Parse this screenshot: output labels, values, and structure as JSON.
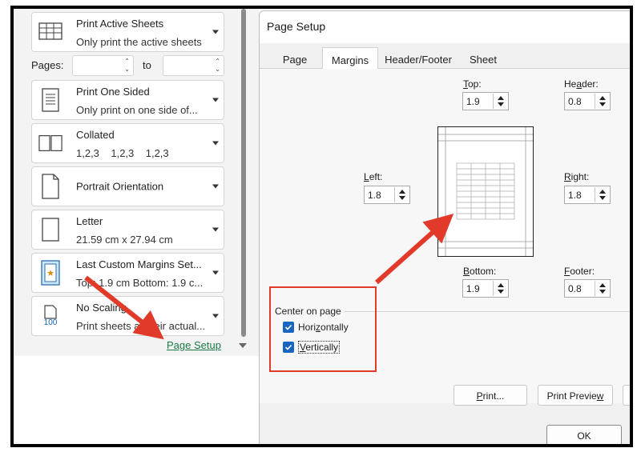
{
  "backstage": {
    "options": [
      {
        "line1": "Print Active Sheets",
        "line2": "Only print the active sheets",
        "icon": "sheets-grid-icon"
      },
      {
        "line1": "Print One Sided",
        "line2": "Only print on one side of...",
        "icon": "one-sided-page-icon"
      },
      {
        "line1": "Collated",
        "line2": "1,2,3    1,2,3    1,2,3",
        "icon": "collated-pages-icon"
      },
      {
        "line1": "Portrait Orientation",
        "line2": "",
        "icon": "portrait-page-icon"
      },
      {
        "line1": "Letter",
        "line2": "21.59 cm x 27.94 cm",
        "icon": "paper-size-icon"
      },
      {
        "line1": "Last Custom Margins Set...",
        "line2": "Top: 1.9 cm Bottom: 1.9 c...",
        "icon": "custom-margins-icon"
      },
      {
        "line1": "No Scaling",
        "line2": "Print sheets at their actual...",
        "icon": "scaling-100-icon"
      }
    ],
    "pages_label": "Pages:",
    "to_label": "to",
    "scaling_icon_text": "100",
    "page_setup_link": "Page Setup"
  },
  "dialog": {
    "title": "Page Setup",
    "tabs": [
      "Page",
      "Margins",
      "Header/Footer",
      "Sheet"
    ],
    "active_tab": "Margins",
    "margins": {
      "top": {
        "label_u": "T",
        "label_rest": "op:",
        "value": "1.9"
      },
      "header": {
        "label_pre": "He",
        "label_u": "a",
        "label_rest": "der:",
        "value": "0.8"
      },
      "left": {
        "label_u": "L",
        "label_rest": "eft:",
        "value": "1.8"
      },
      "right": {
        "label_u": "R",
        "label_rest": "ight:",
        "value": "1.8"
      },
      "bottom": {
        "label_u": "B",
        "label_rest": "ottom:",
        "value": "1.9"
      },
      "footer": {
        "label_u": "F",
        "label_rest": "ooter:",
        "value": "0.8"
      }
    },
    "center_on_page": {
      "title": "Center on page",
      "horizontally": {
        "pre": "Hori",
        "u": "z",
        "rest": "ontally",
        "checked": true
      },
      "vertically": {
        "u": "V",
        "rest": "ertically",
        "checked": true
      }
    },
    "buttons": {
      "print_u": "P",
      "print_rest": "rint...",
      "preview_pre": "Print Previe",
      "preview_u": "w",
      "ok": "OK"
    }
  },
  "colors": {
    "accent": "#1765c0",
    "link": "#1a7a44",
    "annotation": "#e23a2a"
  }
}
